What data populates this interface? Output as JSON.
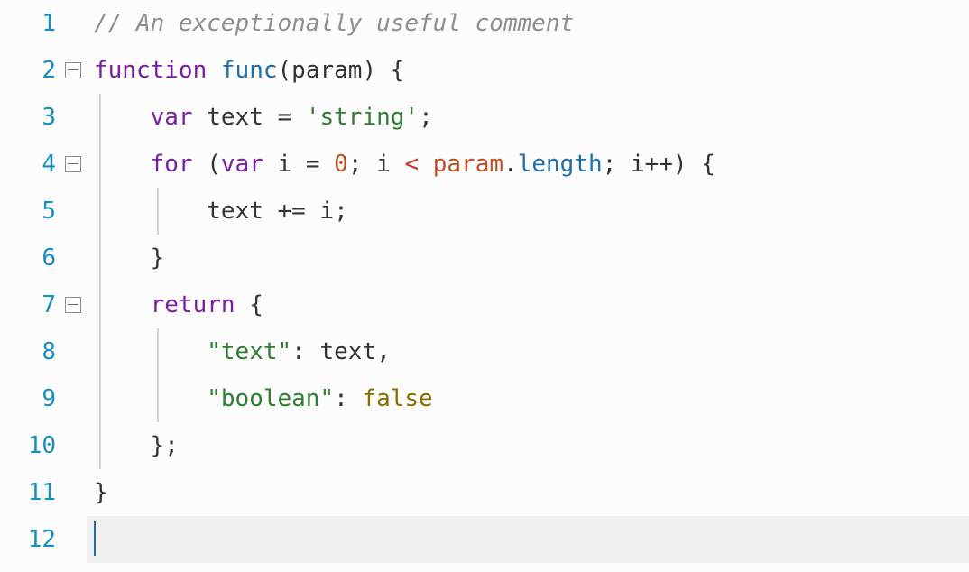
{
  "editor": {
    "lineNumbers": [
      "1",
      "2",
      "3",
      "4",
      "5",
      "6",
      "7",
      "8",
      "9",
      "10",
      "11",
      "12"
    ],
    "fold": {
      "2": true,
      "4": true,
      "7": true
    },
    "currentLine": 12,
    "code": {
      "l1": {
        "comment": "// An exceptionally useful comment"
      },
      "l2": {
        "kw_function": "function",
        "sp": " ",
        "fn_name": "func",
        "open": "(",
        "param": "param",
        "close": ")",
        "sp2": " ",
        "brace": "{"
      },
      "l3": {
        "indent": "    ",
        "kw_var": "var",
        "sp": " ",
        "id": "text",
        "sp2": " ",
        "eq": "=",
        "sp3": " ",
        "str": "'string'",
        "semi": ";"
      },
      "l4": {
        "indent": "    ",
        "kw_for": "for",
        "sp": " ",
        "open": "(",
        "kw_var": "var",
        "sp2": " ",
        "i": "i",
        "sp3": " ",
        "eq": "=",
        "sp4": " ",
        "num": "0",
        "semi1": ";",
        "sp5": " ",
        "i2": "i",
        "sp6": " ",
        "lt": "<",
        "sp7": " ",
        "param": "param",
        "dot": ".",
        "len": "length",
        "semi2": ";",
        "sp8": " ",
        "i3": "i",
        "pp": "++",
        "close": ")",
        "sp9": " ",
        "brace": "{"
      },
      "l5": {
        "indent": "        ",
        "id": "text",
        "sp": " ",
        "pe": "+=",
        "sp2": " ",
        "i": "i",
        "semi": ";"
      },
      "l6": {
        "indent": "    ",
        "brace": "}"
      },
      "l7": {
        "indent": "    ",
        "kw_return": "return",
        "sp": " ",
        "brace": "{"
      },
      "l8": {
        "indent": "        ",
        "key": "\"text\"",
        "colon": ":",
        "sp": " ",
        "val": "text",
        "comma": ","
      },
      "l9": {
        "indent": "        ",
        "key": "\"boolean\"",
        "colon": ":",
        "sp": " ",
        "val": "false"
      },
      "l10": {
        "indent": "    ",
        "brace": "}",
        "semi": ";"
      },
      "l11": {
        "brace": "}"
      },
      "l12": {
        "empty": ""
      }
    }
  }
}
